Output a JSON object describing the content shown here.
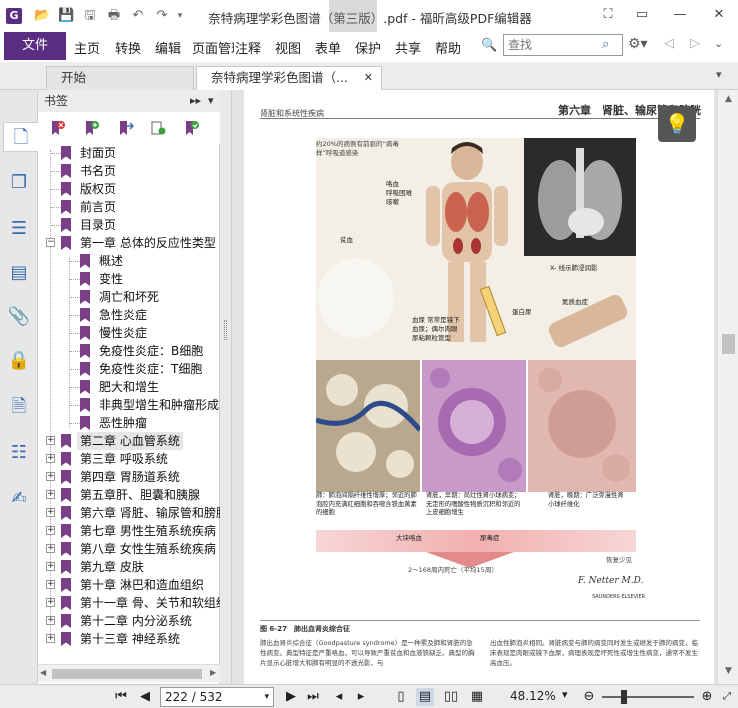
{
  "app": {
    "window_title": "奈特病理学彩色图谱（第三版）.pdf - 福昕高级PDF编辑器",
    "logo_letter": "G"
  },
  "menu": {
    "file": "文件",
    "items": [
      "主页",
      "转换",
      "编辑",
      "页面管理",
      "注释",
      "视图",
      "表单",
      "保护",
      "共享",
      "帮助"
    ],
    "search_placeholder": "查找"
  },
  "tabs": [
    {
      "label": "开始"
    },
    {
      "label": "奈特病理学彩色图谱（..."
    }
  ],
  "bookmark_panel": {
    "title": "书签",
    "items": [
      {
        "label": "封面页",
        "level": 1,
        "expander": ""
      },
      {
        "label": "书名页",
        "level": 1,
        "expander": ""
      },
      {
        "label": "版权页",
        "level": 1,
        "expander": ""
      },
      {
        "label": "前言页",
        "level": 1,
        "expander": ""
      },
      {
        "label": "目录页",
        "level": 1,
        "expander": ""
      },
      {
        "label": "第一章 总体的反应性类型",
        "level": 1,
        "expander": "−"
      },
      {
        "label": "概述",
        "level": 2,
        "expander": ""
      },
      {
        "label": "变性",
        "level": 2,
        "expander": ""
      },
      {
        "label": "凋亡和坏死",
        "level": 2,
        "expander": ""
      },
      {
        "label": "急性炎症",
        "level": 2,
        "expander": ""
      },
      {
        "label": "慢性炎症",
        "level": 2,
        "expander": ""
      },
      {
        "label": "免疫性炎症：B细胞",
        "level": 2,
        "expander": ""
      },
      {
        "label": "免疫性炎症：T细胞",
        "level": 2,
        "expander": ""
      },
      {
        "label": "肥大和增生",
        "level": 2,
        "expander": ""
      },
      {
        "label": "非典型增生和肿瘤形成",
        "level": 2,
        "expander": ""
      },
      {
        "label": "恶性肿瘤",
        "level": 2,
        "expander": ""
      },
      {
        "label": "第二章 心血管系统",
        "level": 1,
        "expander": "+",
        "selected": true
      },
      {
        "label": "第三章 呼吸系统",
        "level": 1,
        "expander": "+"
      },
      {
        "label": "第四章 胃肠道系统",
        "level": 1,
        "expander": "+"
      },
      {
        "label": "第五章肝、胆囊和胰腺",
        "level": 1,
        "expander": "+"
      },
      {
        "label": "第六章 肾脏、输尿管和膀胱",
        "level": 1,
        "expander": "+"
      },
      {
        "label": "第七章 男性生殖系统疾病",
        "level": 1,
        "expander": "+"
      },
      {
        "label": "第八章 女性生殖系统疾病",
        "level": 1,
        "expander": "+"
      },
      {
        "label": "第九章 皮肤",
        "level": 1,
        "expander": "+"
      },
      {
        "label": "第十章 淋巴和造血组织",
        "level": 1,
        "expander": "+"
      },
      {
        "label": "第十一章 骨、关节和软组织",
        "level": 1,
        "expander": "+"
      },
      {
        "label": "第十二章 内分泌系统",
        "level": 1,
        "expander": "+"
      },
      {
        "label": "第十三章 神经系统",
        "level": 1,
        "expander": "+"
      }
    ]
  },
  "document_page": {
    "running_head_left": "肾脏和系统性疾病",
    "running_head_right": "第六章　肾脏、输尿管和膀胱",
    "labels": {
      "top_note": "约20%的病例有前驱的“病毒样”呼吸道感染",
      "hemoptysis": "咯血\n呼吸困难\n咳嗽",
      "anemia": "贫血",
      "xray": "X- 线示肺浸润影",
      "hematuria": "血尿\n常常是镜下血尿；偶尔肉眼尿粘颗粒管型",
      "proteinuria": "蛋白尿",
      "azotemia": "氮质血症",
      "lung_caption": "肺：肺泡间隔纤维性增厚；邻近的肺泡腔内充满红细胞和吞噬含铁血黄素的细胞",
      "kidney_early": "肾脏，早期：局灶性肾小球病变；无定形的嗜酸性物质沉积和邻近的上皮细胞增生",
      "kidney_late": "肾脏，晚期：广泛弥漫性肾小球纤维化",
      "massive_hemoptysis": "大块咯血",
      "uremia": "尿毒症",
      "recovery": "恢复少见",
      "survival": "2～168周内死亡（平均15周）",
      "figure_title": "图 6-27　肺出血肾炎综合征",
      "body_left": "肺出血肾炎综合征（Goodpasture syndrome）是一种累及肺和肾脏的急性病变。典型特征是严重咯血，可以导致严重贫血和血液铁缺乏。典型的胸片显示心脏增大和肺有明显的不透光影，与",
      "body_right": "出血性肺泡炎相同。肾脏病变与肺的病变同时发生或继发于肺的病变，临床表现是肉眼或镜下血尿，病理表现是坏死性或增生性病变，通常不发生高血压。",
      "signature": "F. Netter M.D.",
      "publisher": "SAUNDERS ELSEVIER"
    }
  },
  "status": {
    "page_display": "222 / 532",
    "zoom": "48.12%"
  },
  "colors": {
    "accent": "#5b2d82",
    "bookmark_flag": "#7a3f86",
    "icon_blue": "#3b6db3"
  }
}
